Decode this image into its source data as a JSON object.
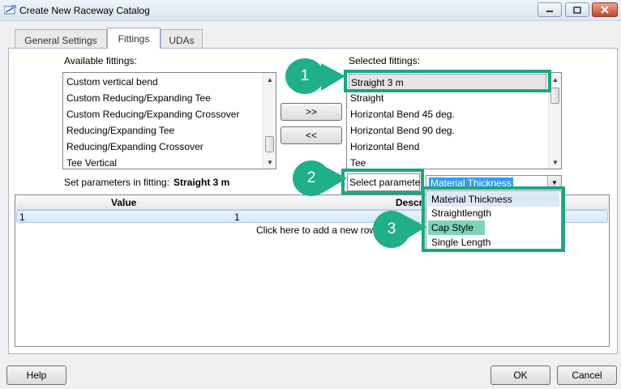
{
  "window": {
    "title": "Create New Raceway Catalog"
  },
  "tabs": [
    {
      "label": "General Settings"
    },
    {
      "label": "Fittings"
    },
    {
      "label": "UDAs"
    }
  ],
  "available": {
    "label": "Available fittings:",
    "items": [
      "Custom vertical bend",
      "Custom Reducing/Expanding Tee",
      "Custom Reducing/Expanding Crossover",
      "Reducing/Expanding Tee",
      "Reducing/Expanding Crossover",
      "Tee Vertical"
    ]
  },
  "selected": {
    "label": "Selected fittings:",
    "items": [
      "Straight 3 m",
      "Straight",
      "Horizontal Bend 45 deg.",
      "Horizontal Bend 90 deg.",
      "Horizontal Bend",
      "Tee"
    ]
  },
  "transfer": {
    "add_label": ">>",
    "remove_label": "<<"
  },
  "parameters": {
    "label": "Set parameters in fitting:",
    "fitting": "Straight 3 m",
    "select_label": "Select parameter",
    "selected_value": "Material Thickness",
    "options": [
      "Material Thickness",
      "Straightlength",
      "Cap Style",
      "Single Length"
    ]
  },
  "grid": {
    "columns": [
      "Value",
      "Descr"
    ],
    "row": [
      "1",
      "1"
    ],
    "add_row_text": "Click here to add a new row"
  },
  "footer": {
    "help_label": "Help",
    "ok_label": "OK",
    "cancel_label": "Cancel"
  },
  "callouts": [
    "1",
    "2",
    "3"
  ],
  "colors": {
    "callout": "#1fb08a",
    "highlight": "#1aa683",
    "selection": "#3399ff"
  }
}
